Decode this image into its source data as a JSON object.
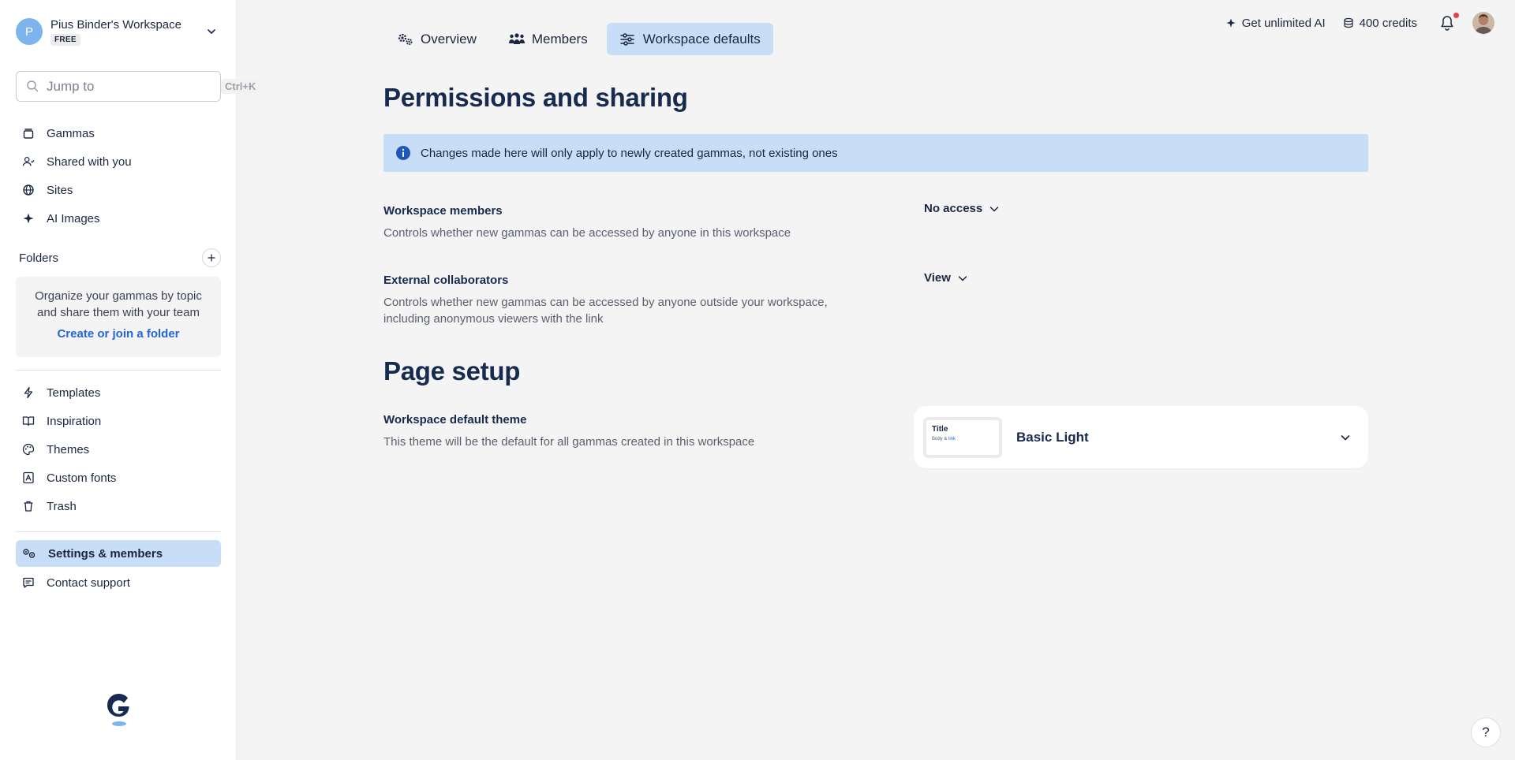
{
  "workspace": {
    "initial": "P",
    "name": "Pius Binder's Workspace",
    "plan": "FREE"
  },
  "search": {
    "placeholder": "Jump to",
    "shortcut": "Ctrl+K"
  },
  "nav_main": [
    {
      "label": "Gammas",
      "icon": "stack-icon"
    },
    {
      "label": "Shared with you",
      "icon": "users-icon"
    },
    {
      "label": "Sites",
      "icon": "globe-icon"
    },
    {
      "label": "AI Images",
      "icon": "sparkle-icon"
    }
  ],
  "folders": {
    "title": "Folders",
    "description": "Organize your gammas by topic and share them with your team",
    "link": "Create or join a folder"
  },
  "nav_secondary": [
    {
      "label": "Templates",
      "icon": "bolt-icon"
    },
    {
      "label": "Inspiration",
      "icon": "book-icon"
    },
    {
      "label": "Themes",
      "icon": "palette-icon"
    },
    {
      "label": "Custom fonts",
      "icon": "font-icon"
    },
    {
      "label": "Trash",
      "icon": "trash-icon"
    }
  ],
  "nav_bottom": [
    {
      "label": "Settings & members",
      "icon": "settings-icon",
      "active": true
    },
    {
      "label": "Contact support",
      "icon": "chat-icon"
    }
  ],
  "tabs": [
    {
      "label": "Overview",
      "icon": "gears-icon"
    },
    {
      "label": "Members",
      "icon": "people-icon"
    },
    {
      "label": "Workspace defaults",
      "icon": "sliders-icon",
      "active": true
    }
  ],
  "topbar": {
    "ai_label": "Get unlimited AI",
    "credits": "400 credits"
  },
  "permissions": {
    "heading": "Permissions and sharing",
    "info": "Changes made here will only apply to newly created gammas, not existing ones",
    "members": {
      "title": "Workspace members",
      "description": "Controls whether new gammas can be accessed by anyone in this workspace",
      "value": "No access"
    },
    "external": {
      "title": "External collaborators",
      "description_line1": "Controls whether new gammas can be accessed by anyone outside your workspace,",
      "description_line2": "including anonymous viewers with the link",
      "value": "View"
    }
  },
  "page_setup": {
    "heading": "Page setup",
    "theme": {
      "title": "Workspace default theme",
      "description": "This theme will be the default for all gammas created in this workspace",
      "selected": "Basic Light",
      "thumb_title": "Title",
      "thumb_body": "Body &",
      "thumb_link": "link"
    }
  },
  "help": {
    "label": "?"
  },
  "colors": {
    "accent": "#c8def7",
    "link": "#2266d8",
    "heading": "#172a4f",
    "notification": "#e54242"
  }
}
